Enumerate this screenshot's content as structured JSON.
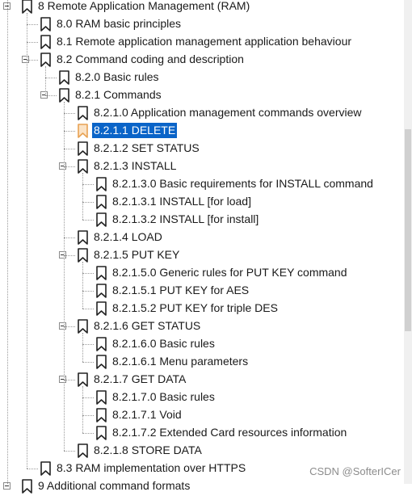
{
  "tree": {
    "items": [
      {
        "label": "8 Remote Application Management (RAM)",
        "level": 0,
        "expanded": true
      },
      {
        "label": "8.0 RAM basic principles",
        "level": 1
      },
      {
        "label": "8.1 Remote application management application behaviour",
        "level": 1
      },
      {
        "label": "8.2 Command coding and description",
        "level": 1,
        "expanded": true
      },
      {
        "label": "8.2.0 Basic rules",
        "level": 2
      },
      {
        "label": "8.2.1 Commands",
        "level": 2,
        "expanded": true
      },
      {
        "label": "8.2.1.0 Application management commands overview",
        "level": 3
      },
      {
        "label": "8.2.1.1 DELETE",
        "level": 3,
        "selected": true
      },
      {
        "label": "8.2.1.2 SET STATUS",
        "level": 3
      },
      {
        "label": "8.2.1.3 INSTALL",
        "level": 3,
        "expanded": true
      },
      {
        "label": "8.2.1.3.0 Basic requirements for INSTALL command",
        "level": 4
      },
      {
        "label": "8.2.1.3.1 INSTALL [for load]",
        "level": 4
      },
      {
        "label": "8.2.1.3.2 INSTALL [for install]",
        "level": 4
      },
      {
        "label": "8.2.1.4 LOAD",
        "level": 3
      },
      {
        "label": "8.2.1.5 PUT KEY",
        "level": 3,
        "expanded": true
      },
      {
        "label": "8.2.1.5.0 Generic rules for PUT KEY command",
        "level": 4
      },
      {
        "label": "8.2.1.5.1 PUT KEY for AES",
        "level": 4
      },
      {
        "label": "8.2.1.5.2 PUT KEY for triple DES",
        "level": 4
      },
      {
        "label": "8.2.1.6 GET STATUS",
        "level": 3,
        "expanded": true
      },
      {
        "label": "8.2.1.6.0 Basic rules",
        "level": 4
      },
      {
        "label": "8.2.1.6.1 Menu parameters",
        "level": 4
      },
      {
        "label": "8.2.1.7 GET DATA",
        "level": 3,
        "expanded": true
      },
      {
        "label": "8.2.1.7.0 Basic rules",
        "level": 4
      },
      {
        "label": "8.2.1.7.1 Void",
        "level": 4
      },
      {
        "label": "8.2.1.7.2 Extended Card resources information",
        "level": 4
      },
      {
        "label": "8.2.1.8 STORE DATA",
        "level": 3
      },
      {
        "label": "8.3 RAM implementation over HTTPS",
        "level": 1
      },
      {
        "label": "9 Additional command formats",
        "level": 0,
        "expanded": true
      }
    ]
  },
  "colors": {
    "selection": "#0a64c8",
    "bookmark": "#222222",
    "bookmark_selected": "#e8a253"
  },
  "watermark": "CSDN @SofterICer"
}
